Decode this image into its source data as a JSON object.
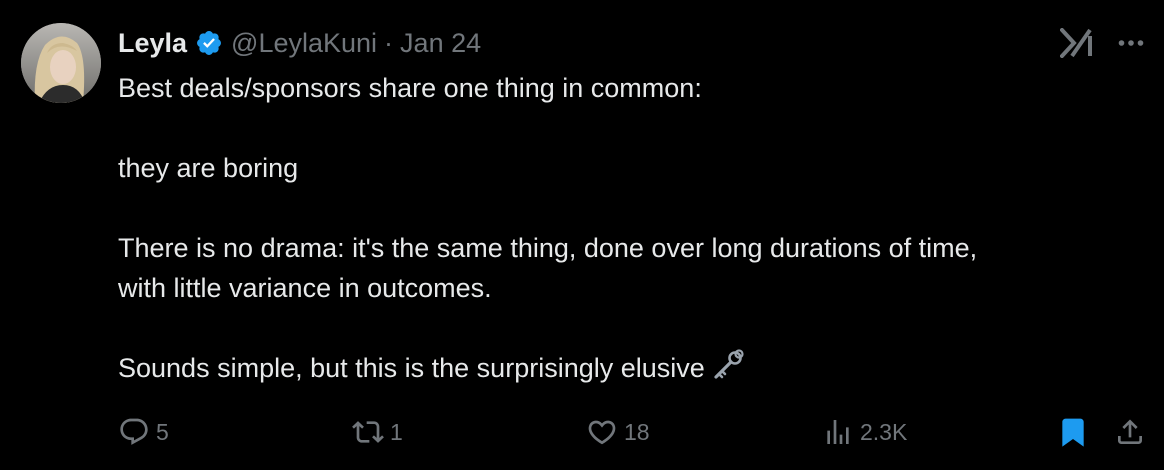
{
  "user": {
    "display_name": "Leyla",
    "handle": "@LeylaKuni",
    "separator": "·",
    "date": "Jan 24",
    "verified_color": "#1d9bf0"
  },
  "tweet": {
    "lines": [
      "Best deals/sponsors share one thing in common:",
      "",
      "they are boring",
      "",
      "There is no drama: it's the same thing, done over long durations of time,",
      "with little variance in outcomes.",
      "",
      "Sounds simple, but this is the surprisingly elusive"
    ],
    "trailing_emoji": "old-key-icon"
  },
  "top_right_icons": [
    "grok-icon",
    "more-icon"
  ],
  "actions": {
    "replies": "5",
    "reposts": "1",
    "likes": "18",
    "views": "2.3K",
    "bookmarked": true
  },
  "colors": {
    "background": "#000000",
    "text": "#e7e9ea",
    "muted": "#71767b",
    "accent": "#1d9bf0"
  }
}
